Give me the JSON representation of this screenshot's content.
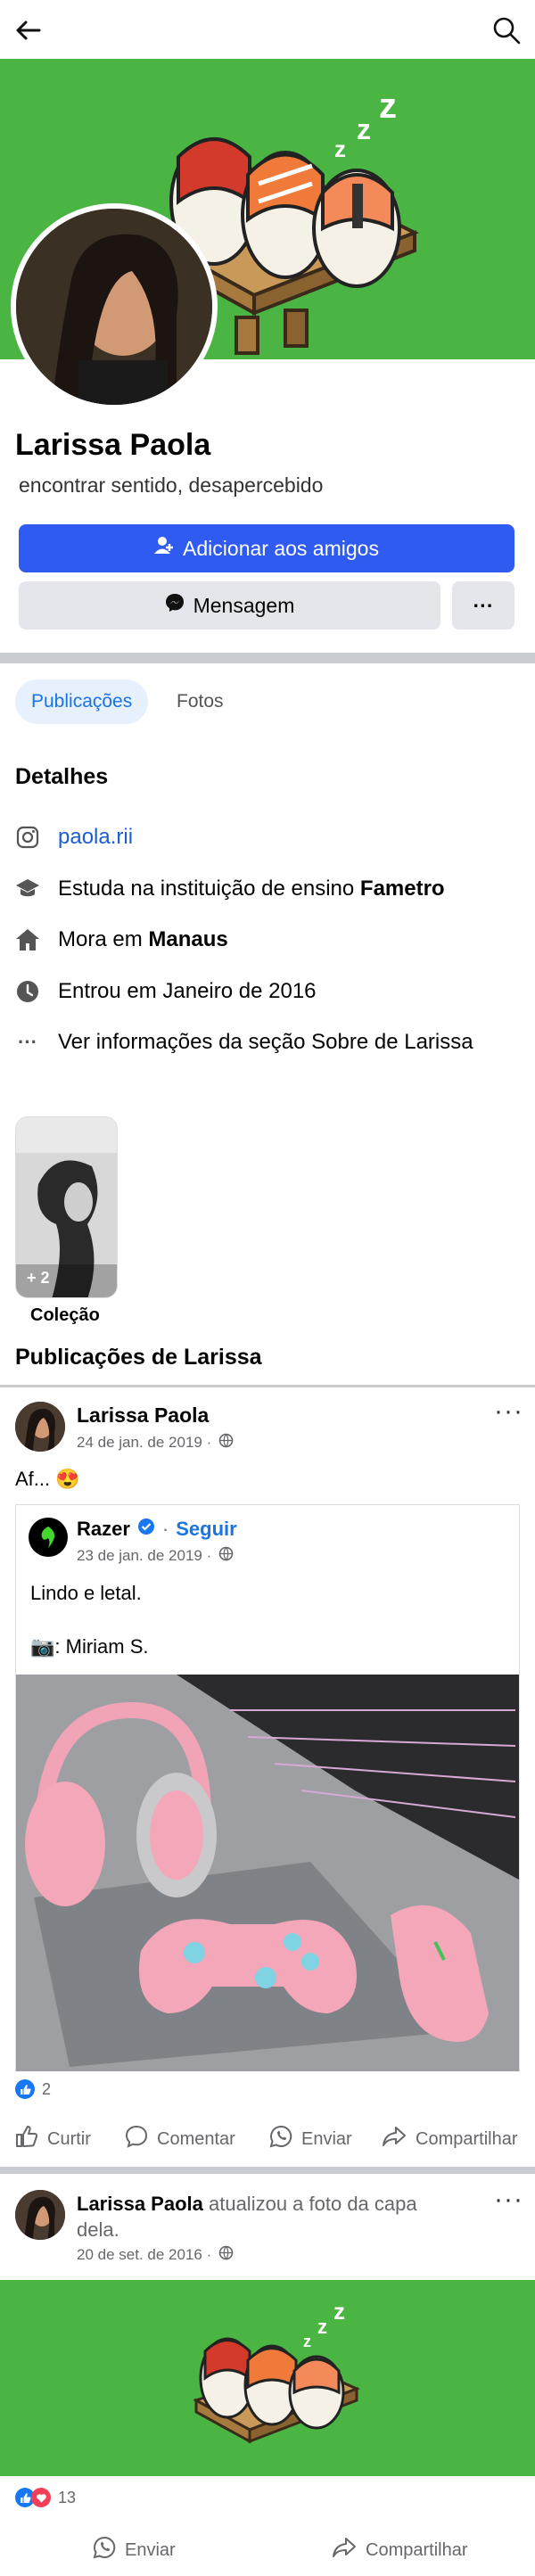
{
  "profile": {
    "name": "Larissa Paola",
    "bio": "encontrar sentido, desapercebido",
    "add_friend_label": "Adicionar aos amigos",
    "message_label": "Mensagem",
    "more_label": "···"
  },
  "tabs": [
    {
      "label": "Publicações",
      "active": true
    },
    {
      "label": "Fotos",
      "active": false
    }
  ],
  "details": {
    "title": "Detalhes",
    "instagram": "paola.rii",
    "study_prefix": "Estuda na instituição de ensino ",
    "study_place": "Fametro",
    "lives_prefix": "Mora em ",
    "lives_place": "Manaus",
    "joined": "Entrou em Janeiro de 2016",
    "see_about": "Ver informações da seção Sobre de Larissa"
  },
  "collection": {
    "count": "+ 2",
    "label": "Coleção"
  },
  "posts_title": "Publicações de Larissa",
  "post1": {
    "author": "Larissa Paola",
    "date": "24 de jan. de 2019 ·",
    "text": "Af...",
    "emoji": "😍",
    "shared": {
      "author": "Razer",
      "follow": "Seguir",
      "separator": "·",
      "date": "23 de jan. de 2019 ·",
      "line1": "Lindo e letal.",
      "line2": "📷: Miriam S."
    },
    "reaction_count": "2",
    "actions": {
      "like": "Curtir",
      "comment": "Comentar",
      "send": "Enviar",
      "share": "Compartilhar"
    }
  },
  "post2": {
    "author": "Larissa Paola",
    "action_text": " atualizou a foto da capa",
    "action_text2": "dela.",
    "date": "20 de set. de 2016 ·",
    "reaction_count": "13",
    "actions": {
      "send": "Enviar",
      "share": "Compartilhar"
    }
  },
  "colors": {
    "brand_blue": "#2f5bf0",
    "cover_green": "#4bb543",
    "link_blue": "#1b74e4"
  }
}
